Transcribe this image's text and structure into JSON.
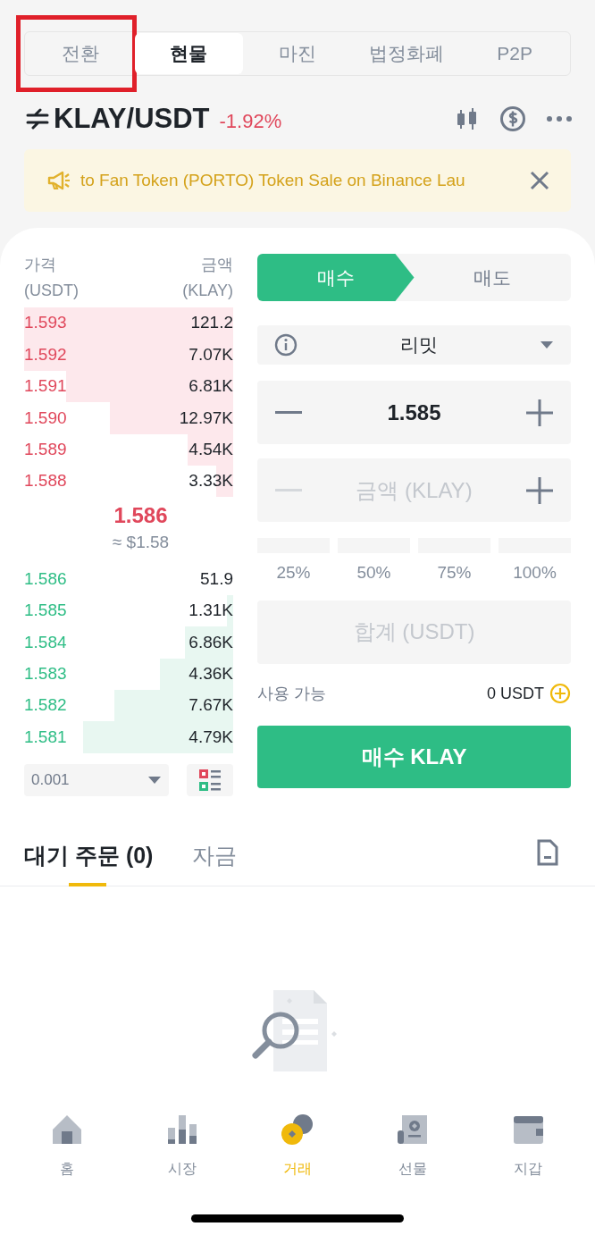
{
  "market_tabs": [
    {
      "label": "전환",
      "selected": false,
      "highlighted": true
    },
    {
      "label": "현물",
      "selected": true,
      "highlighted": false
    },
    {
      "label": "마진",
      "selected": false,
      "highlighted": false
    },
    {
      "label": "법정화폐",
      "selected": false,
      "highlighted": false
    },
    {
      "label": "P2P",
      "selected": false,
      "highlighted": false
    }
  ],
  "pair": {
    "symbol": "KLAY/USDT",
    "change": "-1.92%"
  },
  "banner": {
    "text": "to Fan Token (PORTO) Token Sale on Binance Lau"
  },
  "order_book": {
    "price_header": "가격",
    "price_unit": "(USDT)",
    "amount_header": "금액",
    "amount_unit": "(KLAY)",
    "asks": [
      {
        "price": "1.593",
        "amount": "121.2",
        "level": 1.0
      },
      {
        "price": "1.592",
        "amount": "7.07K",
        "level": 1.0
      },
      {
        "price": "1.591",
        "amount": "6.81K",
        "level": 0.8
      },
      {
        "price": "1.590",
        "amount": "12.97K",
        "level": 0.59
      },
      {
        "price": "1.589",
        "amount": "4.54K",
        "level": 0.22
      },
      {
        "price": "1.588",
        "amount": "3.33K",
        "level": 0.08
      }
    ],
    "last_price": "1.586",
    "last_price_usd": "≈ $1.58",
    "bids": [
      {
        "price": "1.586",
        "amount": "51.9"
      },
      {
        "price": "1.585",
        "amount": "1.31K",
        "level": 0.03
      },
      {
        "price": "1.584",
        "amount": "6.86K",
        "level": 0.23
      },
      {
        "price": "1.583",
        "amount": "4.36K",
        "level": 0.35
      },
      {
        "price": "1.582",
        "amount": "7.67K",
        "level": 0.57
      },
      {
        "price": "1.581",
        "amount": "4.79K",
        "level": 0.72
      }
    ],
    "precision": "0.001"
  },
  "order_form": {
    "sides": [
      {
        "label": "매수",
        "selected": true
      },
      {
        "label": "매도",
        "selected": false
      }
    ],
    "order_type": "리밋",
    "price": "1.585",
    "amount_placeholder": "금액 (KLAY)",
    "percentages": [
      "25%",
      "50%",
      "75%",
      "100%"
    ],
    "total_placeholder": "합계 (USDT)",
    "available_label": "사용 가능",
    "available_value": "0 USDT",
    "submit": "매수 KLAY"
  },
  "orders_tabs": [
    {
      "label": "대기 주문 (0)",
      "selected": true
    },
    {
      "label": "자금",
      "selected": false
    }
  ],
  "bottom_nav": [
    {
      "label": "홈",
      "selected": false
    },
    {
      "label": "시장",
      "selected": false
    },
    {
      "label": "거래",
      "selected": true
    },
    {
      "label": "선물",
      "selected": false
    },
    {
      "label": "지갑",
      "selected": false
    }
  ]
}
